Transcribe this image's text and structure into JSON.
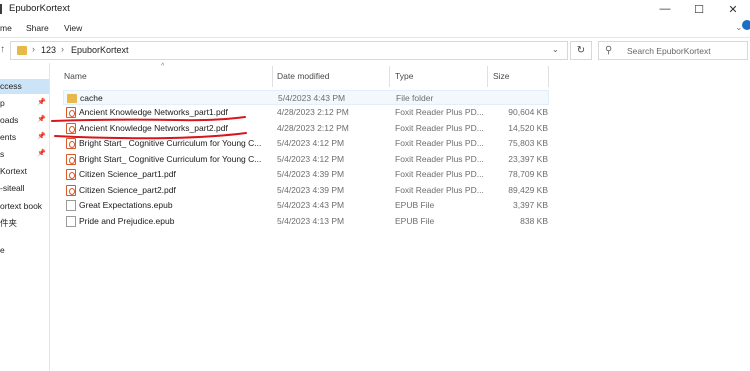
{
  "window": {
    "title": "EpuborKortext",
    "min_glyph": "—",
    "max_glyph": "☐",
    "close_glyph": "✕",
    "icon": "folder-icon"
  },
  "ribbon": {
    "tabs": [
      "me",
      "Share",
      "View"
    ],
    "expand_glyph": "⌄"
  },
  "address": {
    "up_glyph": "↑",
    "sep": "›",
    "crumbs": [
      "123",
      "EpuborKortext"
    ],
    "dropdown_glyph": "⌄",
    "refresh_glyph": "↻",
    "search_placeholder": "Search EpuborKortext",
    "search_glyph": "⚲"
  },
  "sidebar": {
    "items": [
      {
        "label": "ccess",
        "pinned": false,
        "selected": true
      },
      {
        "label": "p",
        "pinned": true,
        "selected": false
      },
      {
        "label": "oads",
        "pinned": true,
        "selected": false
      },
      {
        "label": "ents",
        "pinned": true,
        "selected": false
      },
      {
        "label": "s",
        "pinned": true,
        "selected": false
      },
      {
        "label": "Kortext",
        "pinned": false,
        "selected": false
      },
      {
        "label": "-siteall",
        "pinned": false,
        "selected": false
      },
      {
        "label": "ortext book",
        "pinned": false,
        "selected": false
      },
      {
        "label": "件夹",
        "pinned": false,
        "selected": false
      },
      {
        "label": "",
        "pinned": false,
        "selected": false
      },
      {
        "label": "e",
        "pinned": false,
        "selected": false
      }
    ],
    "pin_glyph": "📌"
  },
  "columns": {
    "sort_caret": "^",
    "name": "Name",
    "date": "Date modified",
    "type": "Type",
    "size": "Size"
  },
  "files": [
    {
      "name": "cache",
      "date": "5/4/2023 4:43 PM",
      "type": "File folder",
      "size": "",
      "icon": "folder-icon"
    },
    {
      "name": "Ancient Knowledge Networks_part1.pdf",
      "date": "4/28/2023 2:12 PM",
      "type": "Foxit Reader Plus PD...",
      "size": "90,604 KB",
      "icon": "pdf-icon"
    },
    {
      "name": "Ancient Knowledge Networks_part2.pdf",
      "date": "4/28/2023 2:12 PM",
      "type": "Foxit Reader Plus PD...",
      "size": "14,520 KB",
      "icon": "pdf-icon"
    },
    {
      "name": "Bright Start_ Cognitive Curriculum for Young C...",
      "date": "5/4/2023 4:12 PM",
      "type": "Foxit Reader Plus PD...",
      "size": "75,803 KB",
      "icon": "pdf-icon"
    },
    {
      "name": "Bright Start_ Cognitive Curriculum for Young C...",
      "date": "5/4/2023 4:12 PM",
      "type": "Foxit Reader Plus PD...",
      "size": "23,397 KB",
      "icon": "pdf-icon"
    },
    {
      "name": "Citizen Science_part1.pdf",
      "date": "5/4/2023 4:39 PM",
      "type": "Foxit Reader Plus PD...",
      "size": "78,709 KB",
      "icon": "pdf-icon"
    },
    {
      "name": "Citizen Science_part2.pdf",
      "date": "5/4/2023 4:39 PM",
      "type": "Foxit Reader Plus PD...",
      "size": "89,429 KB",
      "icon": "pdf-icon"
    },
    {
      "name": "Great Expectations.epub",
      "date": "5/4/2023 4:43 PM",
      "type": "EPUB File",
      "size": "3,397 KB",
      "icon": "epub-icon"
    },
    {
      "name": "Pride and Prejudice.epub",
      "date": "5/4/2023 4:13 PM",
      "type": "EPUB File",
      "size": "838 KB",
      "icon": "epub-icon"
    }
  ],
  "colors": {
    "annotation_red": "#d8161b",
    "selection_blue": "#cce4f7",
    "folder_yellow": "#e6b94a",
    "pdf_orange": "#d65a2a"
  }
}
